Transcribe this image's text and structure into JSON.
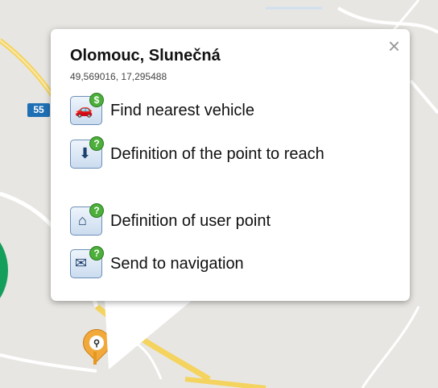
{
  "map": {
    "road_number": "55"
  },
  "popup": {
    "title": "Olomouc, Slunečná",
    "coordinates": "49,569016, 17,295488",
    "close_label": "×",
    "items": [
      {
        "label": "Find nearest vehicle",
        "icon": "car-search-icon"
      },
      {
        "label": "Definition of the point to reach",
        "icon": "download-point-icon"
      },
      {
        "label": "Definition of user point",
        "icon": "house-icon"
      },
      {
        "label": "Send to navigation",
        "icon": "car-mail-icon"
      }
    ]
  },
  "marker": {
    "icon": "search-marker-icon",
    "color": "#f2a93b"
  },
  "colors": {
    "road_badge": "#1f6fb4",
    "park": "#149e5b",
    "road_yellow": "#f4d35e"
  }
}
